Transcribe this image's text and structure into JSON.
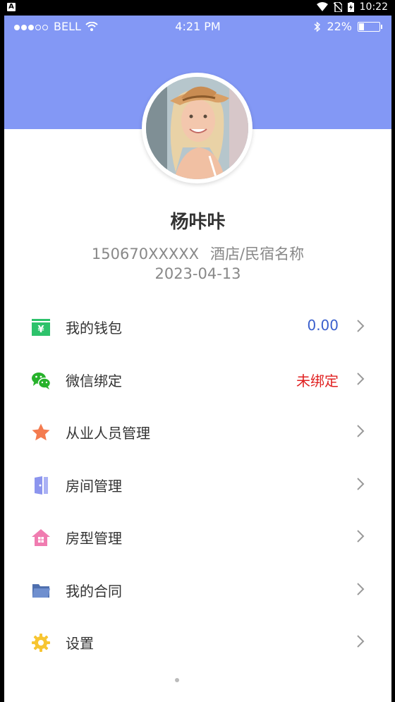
{
  "system_bar": {
    "badge": "A",
    "time": "10:22"
  },
  "ios_status": {
    "carrier": "BELL",
    "time": "4:21 PM",
    "battery": "22%",
    "battery_level": 0.22
  },
  "profile": {
    "name": "杨咔咔",
    "phone": "150670XXXXX",
    "hotel": "酒店/民宿名称",
    "date": "2023-04-13"
  },
  "menu": [
    {
      "label": "我的钱包",
      "value": "0.00",
      "value_color": "#3A5FCD",
      "icon": "wallet-icon"
    },
    {
      "label": "微信绑定",
      "value": "未绑定",
      "value_color": "#E02020",
      "icon": "wechat-icon"
    },
    {
      "label": "从业人员管理",
      "value": "",
      "icon": "star-icon"
    },
    {
      "label": "房间管理",
      "value": "",
      "icon": "door-icon"
    },
    {
      "label": "房型管理",
      "value": "",
      "icon": "house-icon"
    },
    {
      "label": "我的合同",
      "value": "",
      "icon": "folder-icon"
    },
    {
      "label": "设置",
      "value": "",
      "icon": "gear-icon"
    }
  ],
  "colors": {
    "header": "#8398F5",
    "wallet": "#2DC26B",
    "wechat": "#27B22B",
    "star": "#F47B4F",
    "door": "#8C95EE",
    "house": "#F07CB0",
    "folder": "#5C7FC0",
    "gear": "#F7C531"
  }
}
